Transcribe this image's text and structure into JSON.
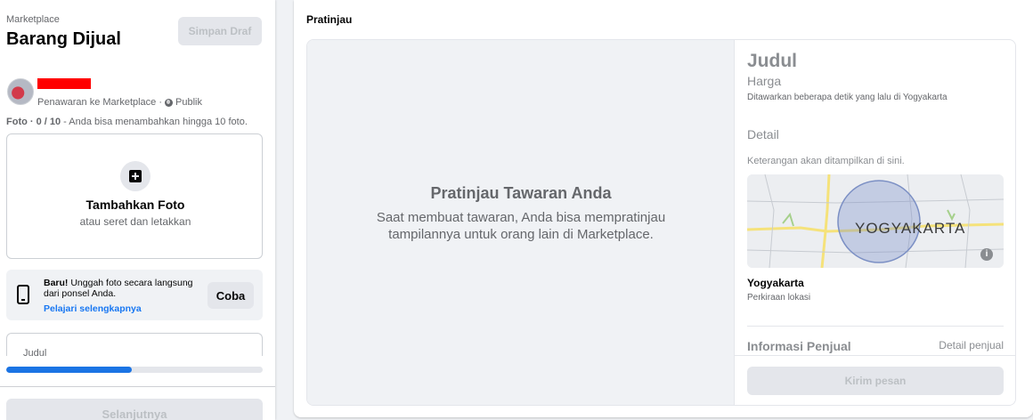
{
  "left_panel": {
    "breadcrumb": "Marketplace",
    "title": "Barang Dijual",
    "save_draft_label": "Simpan Draf",
    "posting_meta": "Penawaran ke Marketplace · ",
    "audience": "Publik",
    "photo_count": "Foto · 0 / 10",
    "photo_hint": " - Anda bisa menambahkan hingga 10 foto.",
    "add_photo_title": "Tambahkan Foto",
    "add_photo_sub": "atau seret dan letakkan",
    "mobile_upload": {
      "new_label": "Baru!",
      "text": " Unggah foto secara langsung dari ponsel Anda.",
      "link": "Pelajari selengkapnya",
      "try_label": "Coba"
    },
    "title_field_placeholder": "Judul",
    "progress": 0.49,
    "next_label": "Selanjutnya"
  },
  "preview": {
    "label": "Pratinjau",
    "media_title": "Pratinjau Tawaran Anda",
    "media_sub": "Saat membuat tawaran, Anda bisa mempratinjau tampilannya untuk orang lain di Marketplace.",
    "judul": "Judul",
    "harga": "Harga",
    "offered": "Ditawarkan beberapa detik yang lalu di Yogyakarta",
    "detail": "Detail",
    "desc": "Keterangan akan ditampilkan di sini.",
    "map_label": "YOGYAKARTA",
    "map_info_icon": "i",
    "city": "Yogyakarta",
    "approx": "Perkiraan lokasi",
    "seller_info": "Informasi Penjual",
    "seller_detail": "Detail penjual",
    "send_label": "Kirim pesan"
  },
  "colors": {
    "accent": "#1b74e4",
    "link": "#1877f2",
    "redaction": "#ff0000"
  }
}
